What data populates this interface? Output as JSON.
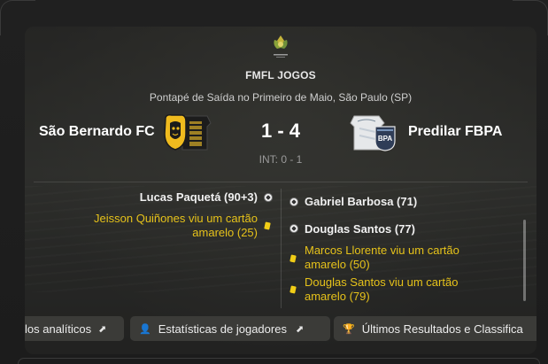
{
  "match": {
    "league_title": "FMFL JOGOS",
    "venue": "Pontapé de Saída no Primeiro de Maio, São Paulo (SP)",
    "home_team": "São Bernardo FC",
    "away_team": "Predilar FBPA",
    "score": "1 - 4",
    "halftime": "INT: 0 - 1"
  },
  "events": {
    "home": [
      {
        "type": "goal",
        "text": "Lucas Paquetá (90+3)"
      },
      {
        "type": "yellow_card",
        "text_line1": "Jeisson Quiñones viu um cartão",
        "text_line2": "amarelo (25)"
      }
    ],
    "away": [
      {
        "type": "goal",
        "text": "Gabriel Barbosa (71)"
      },
      {
        "type": "goal",
        "text": "Douglas Santos (77)"
      },
      {
        "type": "yellow_card",
        "text_line1": "Marcos Llorente viu um cartão",
        "text_line2": "amarelo (50)"
      },
      {
        "type": "yellow_card",
        "text_line1": "Douglas Santos viu um cartão",
        "text_line2": "amarelo (79)"
      }
    ]
  },
  "buttons": {
    "analytics": "los analíticos",
    "player_stats": "Estatísticas de jogadores",
    "results": "Últimos Resultados e Classifica"
  },
  "icons": {
    "external": "external-link-icon",
    "person": "person-icon",
    "trophy": "trophy-icon",
    "ball": "ball-icon",
    "yellow_card": "yellow-card-icon"
  },
  "colors": {
    "yellow_card": "#e6c21a",
    "text": "#e8e8e8",
    "button_bg": "#3b3b38"
  }
}
